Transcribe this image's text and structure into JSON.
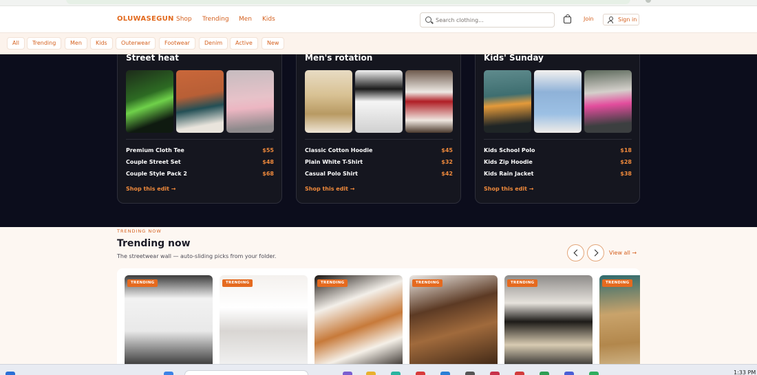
{
  "nav": {
    "brand": "OLUWASEGUN",
    "links": [
      "Shop",
      "Trending",
      "Men",
      "Kids"
    ],
    "search_placeholder": "Search clothing...",
    "join": "Join",
    "signin": "Sign in"
  },
  "chips": [
    "All",
    "Trending",
    "Men",
    "Kids",
    "Outerwear",
    "Footwear",
    "Denim",
    "Active",
    "New"
  ],
  "edits": [
    {
      "title": "Street heat",
      "items": [
        {
          "name": "Premium Cloth Tee",
          "price": "$55"
        },
        {
          "name": "Couple Street Set",
          "price": "$48"
        },
        {
          "name": "Couple Style Pack 2",
          "price": "$68"
        }
      ],
      "link": "Shop this edit →"
    },
    {
      "title": "Men's rotation",
      "items": [
        {
          "name": "Classic Cotton Hoodie",
          "price": "$45"
        },
        {
          "name": "Plain White T-Shirt",
          "price": "$32"
        },
        {
          "name": "Casual Polo Shirt",
          "price": "$42"
        }
      ],
      "link": "Shop this edit →"
    },
    {
      "title": "Kids' Sunday",
      "items": [
        {
          "name": "Kids School Polo",
          "price": "$18"
        },
        {
          "name": "Kids Zip Hoodie",
          "price": "$28"
        },
        {
          "name": "Kids Rain Jacket",
          "price": "$38"
        }
      ],
      "link": "Shop this edit →"
    }
  ],
  "trending": {
    "kicker": "TRENDING NOW",
    "title": "Trending now",
    "subtitle": "The streetwear wall — auto-sliding picks from your folder.",
    "view_all": "View all →",
    "badge": "TRENDING"
  },
  "taskbar": {
    "time": "1:33 PM"
  }
}
